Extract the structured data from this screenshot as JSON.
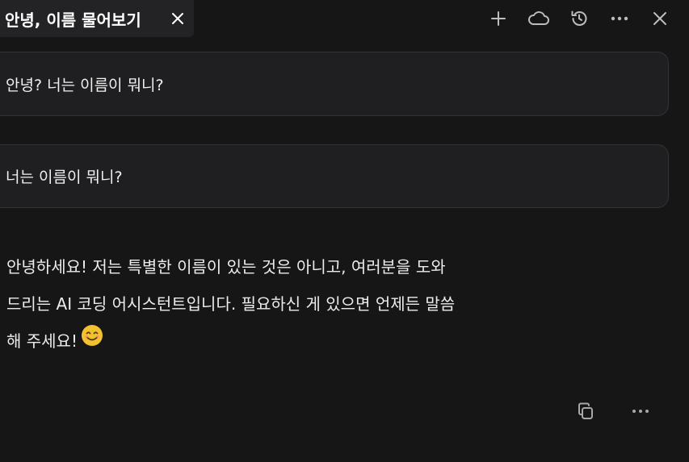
{
  "tab": {
    "title": "안녕, 이름 물어보기"
  },
  "toolbar": {
    "icons": [
      "plus-icon",
      "cloud-icon",
      "history-icon",
      "more-icon",
      "close-icon"
    ]
  },
  "messages": {
    "user_1": "안녕? 너는 이름이 뭐니?",
    "user_2": "너는 이름이 뭐니?",
    "assistant": "안녕하세요! 저는 특별한 이름이 있는 것은 아니고, 여러분을 도와\n드리는 AI 코딩 어시스턴트입니다. 필요하신 게 있으면 언제든 말씀\n해 주세요!"
  },
  "message_actions": {
    "icons": [
      "copy-icon",
      "more-icon"
    ]
  },
  "colors": {
    "background": "#161617",
    "bubble": "#1f1f21",
    "bubble_border": "#333336",
    "tab": "#232325",
    "icon": "#bdbdbd",
    "emoji": "#f2c130"
  }
}
